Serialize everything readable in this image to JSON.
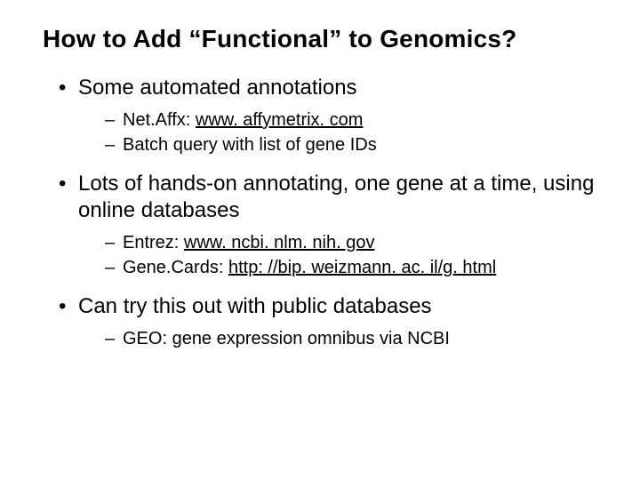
{
  "title": "How to Add “Functional” to Genomics?",
  "bullets": [
    {
      "text": "Some automated annotations",
      "sub": [
        {
          "prefix": "Net.Affx: ",
          "link": "www. affymetrix. com",
          "suffix": ""
        },
        {
          "prefix": "Batch query with list of gene IDs",
          "link": "",
          "suffix": ""
        }
      ]
    },
    {
      "text": "Lots of hands-on annotating, one gene at a time, using online databases",
      "sub": [
        {
          "prefix": "Entrez: ",
          "link": "www. ncbi. nlm. nih. gov",
          "suffix": ""
        },
        {
          "prefix": "Gene.Cards: ",
          "link": "http: //bip. weizmann. ac. il/g. html",
          "suffix": ""
        }
      ]
    },
    {
      "text": "Can try this out with public databases",
      "sub": [
        {
          "prefix": "GEO: gene expression omnibus via NCBI",
          "link": "",
          "suffix": ""
        }
      ]
    }
  ]
}
